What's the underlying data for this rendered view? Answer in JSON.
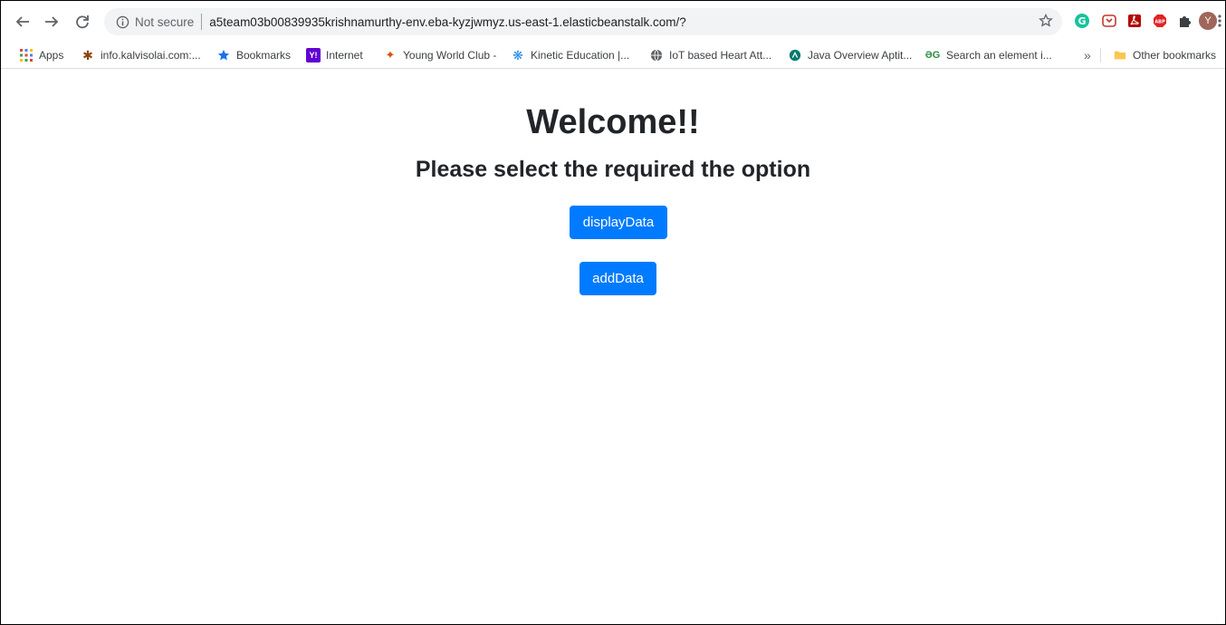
{
  "browser": {
    "security_label": "Not secure",
    "url": "a5team03b00839935krishnamurthy-env.eba-kyzjwmyz.us-east-1.elasticbeanstalk.com/?",
    "profile_initial": "Y",
    "accent_color": "#007bff"
  },
  "bookmarks": {
    "items": [
      {
        "label": "Apps",
        "icon": "apps-grid-icon"
      },
      {
        "label": "info.kalvisolai.com:...",
        "icon": "kalvisolai-icon"
      },
      {
        "label": "Bookmarks",
        "icon": "star-icon"
      },
      {
        "label": "Internet",
        "icon": "yahoo-icon"
      },
      {
        "label": "Young World Club -",
        "icon": "young-world-icon"
      },
      {
        "label": "Kinetic Education |...",
        "icon": "kinetic-icon"
      },
      {
        "label": "IoT based Heart Att...",
        "icon": "globe-icon"
      },
      {
        "label": "Java Overview Aptit...",
        "icon": "java-icon"
      },
      {
        "label": "Search an element i...",
        "icon": "geeksforgeeks-icon"
      }
    ],
    "overflow_label": "»",
    "other_label": "Other bookmarks"
  },
  "page": {
    "title": "Welcome!!",
    "subtitle": "Please select the required the option",
    "buttons": {
      "display": "displayData",
      "add": "addData"
    }
  }
}
